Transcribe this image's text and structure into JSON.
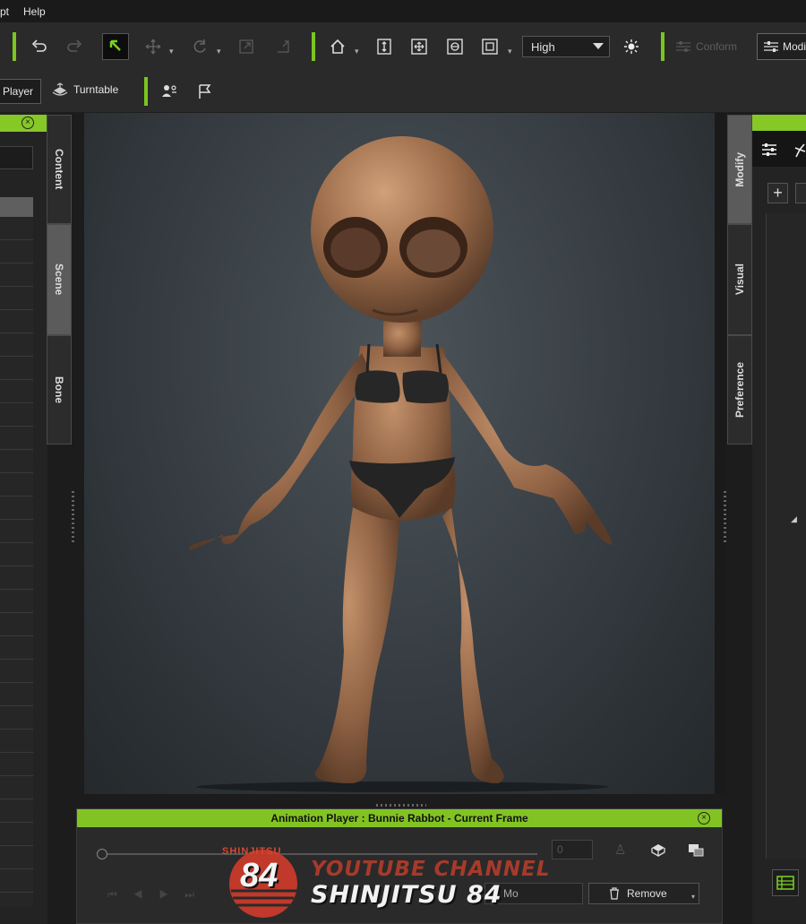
{
  "menu": {
    "item_script": "pt",
    "item_help": "Help"
  },
  "toolbar": {
    "quality": "High",
    "conform_label": "Conform",
    "modify_label": "Modif"
  },
  "toolbar2": {
    "player_label": "Player",
    "turntable_label": "Turntable"
  },
  "left_tabs": {
    "content": "Content",
    "scene": "Scene",
    "bone": "Bone"
  },
  "right_tabs": {
    "modify": "Modify",
    "visual": "Visual",
    "preference": "Preference"
  },
  "animation_player": {
    "title": "Animation Player : Bunnie Rabbot - Current Frame",
    "frame_value": "0",
    "remove_label": "Remove",
    "mode_label": "Mo"
  },
  "watermark": {
    "badge_top": "SHINJITSU",
    "badge_number": "84",
    "line1": "YOUTUBE CHANNEL",
    "line2": "SHINJITSU 84"
  },
  "colors": {
    "accent_green": "#86c826",
    "background": "#2a2a2a",
    "watermark_red": "#c0392b"
  }
}
